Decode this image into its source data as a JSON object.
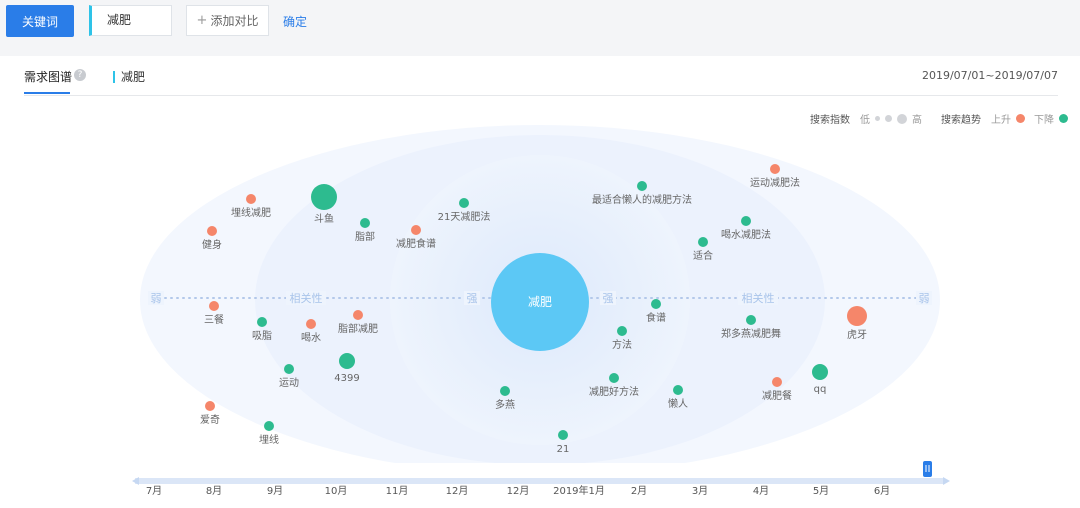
{
  "toolbar": {
    "keyword_button": "关键词",
    "keyword_value": "减肥",
    "add_compare": "添加对比",
    "confirm": "确定"
  },
  "tabs": {
    "active": "需求图谱",
    "keyword_tag": "减肥",
    "date_range": "2019/07/01~2019/07/07"
  },
  "legend": {
    "index_label": "搜索指数",
    "low": "低",
    "high": "高",
    "trend_label": "搜索趋势",
    "up": "上升",
    "down": "下降",
    "up_color": "#f5866a",
    "down_color": "#2dbb8f"
  },
  "chart_data": {
    "type": "bubble-graph",
    "center": "减肥",
    "axis_labels": {
      "weak": "弱",
      "strong": "强",
      "relevance": "相关性"
    },
    "nodes": [
      {
        "label": "埋线减肥",
        "trend": "up"
      },
      {
        "label": "健身",
        "trend": "up"
      },
      {
        "label": "斗鱼",
        "trend": "down"
      },
      {
        "label": "脂部",
        "trend": "down"
      },
      {
        "label": "减肥食谱",
        "trend": "up"
      },
      {
        "label": "21天减肥法",
        "trend": "down"
      },
      {
        "label": "最适合懒人的减肥方法",
        "trend": "down"
      },
      {
        "label": "运动减肥法",
        "trend": "up"
      },
      {
        "label": "喝水减肥法",
        "trend": "down"
      },
      {
        "label": "适合",
        "trend": "down"
      },
      {
        "label": "三餐",
        "trend": "up"
      },
      {
        "label": "吸脂",
        "trend": "down"
      },
      {
        "label": "喝水",
        "trend": "up"
      },
      {
        "label": "脂部减肥",
        "trend": "up"
      },
      {
        "label": "4399",
        "trend": "down"
      },
      {
        "label": "运动",
        "trend": "down"
      },
      {
        "label": "食谱",
        "trend": "down"
      },
      {
        "label": "方法",
        "trend": "down"
      },
      {
        "label": "郑多燕减肥舞",
        "trend": "down"
      },
      {
        "label": "虎牙",
        "trend": "up"
      },
      {
        "label": "爱奇",
        "trend": "up"
      },
      {
        "label": "埋线",
        "trend": "down"
      },
      {
        "label": "多燕",
        "trend": "down"
      },
      {
        "label": "减肥好方法",
        "trend": "down"
      },
      {
        "label": "懒人",
        "trend": "down"
      },
      {
        "label": "减肥餐",
        "trend": "up"
      },
      {
        "label": "qq",
        "trend": "down"
      },
      {
        "label": "21",
        "trend": "down"
      }
    ]
  },
  "timeline": {
    "months": [
      "7月",
      "8月",
      "9月",
      "10月",
      "11月",
      "12月",
      "12月",
      "2019年1月",
      "2月",
      "3月",
      "4月",
      "5月",
      "6月"
    ]
  }
}
